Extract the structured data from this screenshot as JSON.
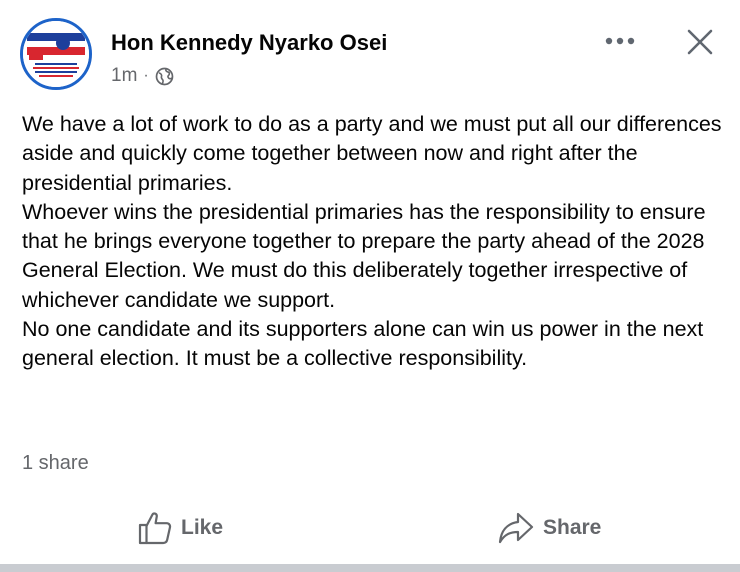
{
  "post": {
    "author": "Hon Kennedy Nyarko Osei",
    "time": "1m",
    "separator": "·",
    "privacy_icon": "globe-icon",
    "paragraphs": [
      "We have a lot of work to do as a party and we must put all our differences aside and quickly come together between now and right after the presidential primaries.",
      "Whoever wins the presidential primaries has the responsibility to ensure that he brings everyone together to prepare the party ahead of the 2028 General Election. We must do this deliberately together irrespective of whichever candidate we support.",
      "No one candidate and its supporters alone can win us power in the next general election.  It must be a collective responsibility."
    ],
    "share_count": "1 share"
  },
  "header": {
    "more_icon": "more-icon",
    "close_icon": "close-icon"
  },
  "actions": {
    "like_label": "Like",
    "share_label": "Share"
  },
  "colors": {
    "primary_text": "#050505",
    "secondary_text": "#65676b",
    "avatar_ring": "#1d63c9",
    "divider": "#c9ccd1"
  }
}
